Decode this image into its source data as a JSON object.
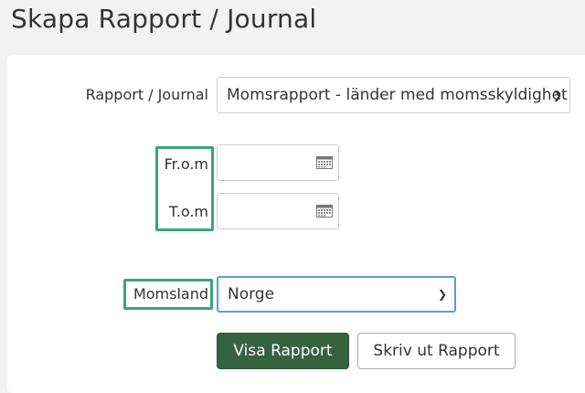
{
  "page": {
    "title": "Skapa Rapport / Journal"
  },
  "form": {
    "report_label": "Rapport / Journal",
    "report_value": "Momsrapport - länder med momsskyldighet",
    "from_label": "Fr.o.m",
    "from_value": "",
    "to_label": "T.o.m",
    "to_value": "",
    "country_label": "Momsland",
    "country_value": "Norge"
  },
  "buttons": {
    "show_report": "Visa Rapport",
    "print_report": "Skriv ut Rapport"
  },
  "icons": {
    "calendar": "calendar-icon",
    "chevron": "chevron-down-icon"
  },
  "colors": {
    "primary_button": "#35633f",
    "highlight": "#3aa37c",
    "focus_border": "#5b9bd5"
  }
}
